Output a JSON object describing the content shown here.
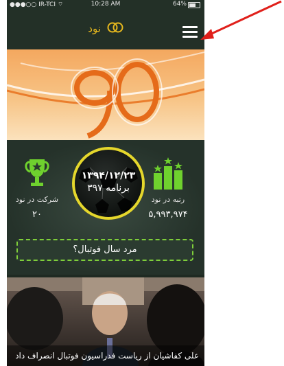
{
  "status_bar": {
    "carrier": "●●●○○ IR-TCI ⌔",
    "time": "10:28 AM",
    "battery": "64%"
  },
  "nav": {
    "title": "نود",
    "menu_icon": "hamburger-menu-icon"
  },
  "stats": {
    "date": "۱۳۹۴/۱۲/۲۳",
    "program": "برنامه ۳۹۷",
    "participation_label": "شرکت در نود",
    "participation_value": "۲۰",
    "rank_label": "رتبه در نود",
    "rank_value": "۵,۹۹۳,۹۷۴"
  },
  "cta": {
    "label": "مرد سال فوتبال؟"
  },
  "news": {
    "headline": "علی کفاشیان از ریاست فدراسیون فوتبال انصراف داد"
  },
  "colors": {
    "accent": "#e6b81e",
    "cta_border": "#7fcf3a",
    "annotation": "#e0201b"
  }
}
